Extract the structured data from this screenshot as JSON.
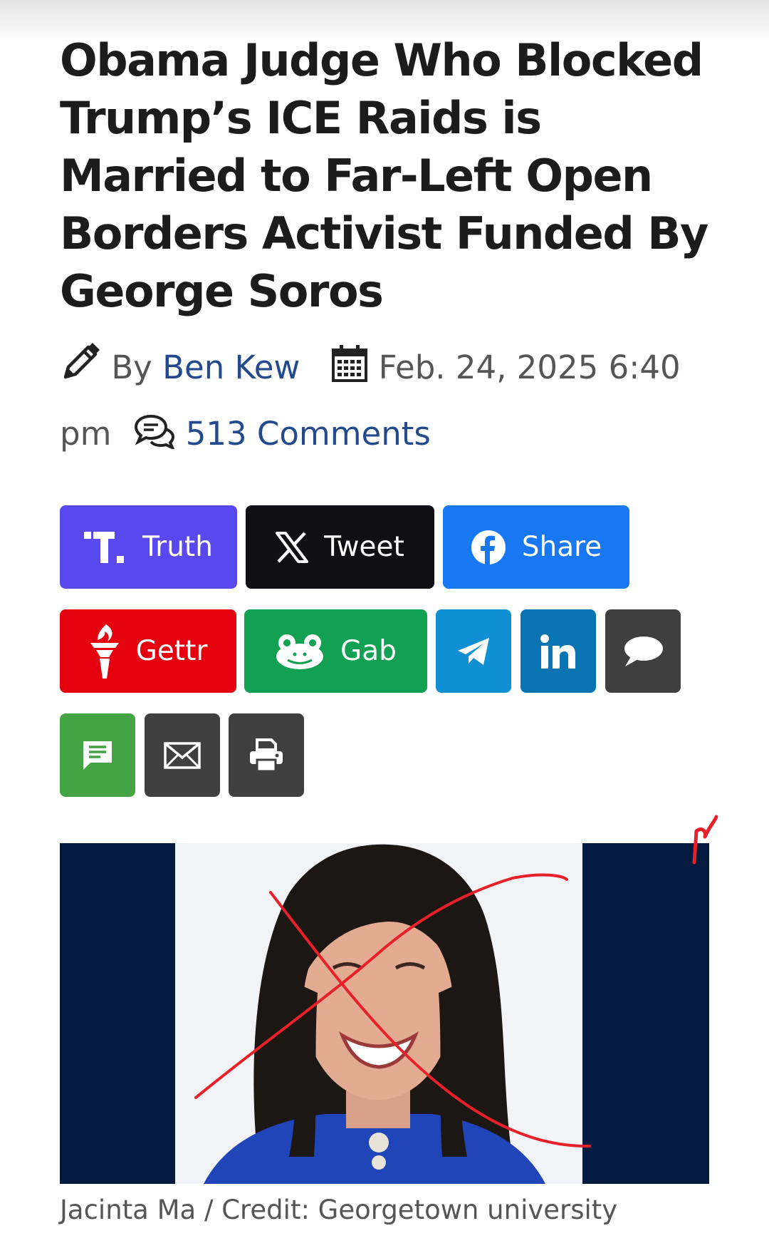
{
  "article": {
    "headline": "Obama Judge Who Blocked Trump’s ICE Raids is Married to Far-Left Open Borders Activist Funded By George Soros",
    "byline_prefix": "By",
    "author": "Ben Kew",
    "date": "Feb. 24, 2025 6:40 pm",
    "comments_label": "513 Comments"
  },
  "share": {
    "truth": "Truth",
    "tweet": "Tweet",
    "facebook": "Share",
    "gettr": "Gettr",
    "gab": "Gab"
  },
  "image": {
    "caption": "Jacinta Ma / Credit: Georgetown university"
  },
  "colors": {
    "truth": "#5948ee",
    "tweet": "#101014",
    "facebook": "#1877f2",
    "gettr": "#e5020e",
    "gab": "#12a152",
    "telegram": "#0f90d2",
    "linkedin": "#0a74b2",
    "dark_gray": "#3f3f3f",
    "sms": "#44a342",
    "link_blue": "#234a8c",
    "scribble_red": "#e8202a"
  },
  "icons": [
    "pencil-icon",
    "calendar-icon",
    "comments-icon",
    "truth-social-icon",
    "x-icon",
    "facebook-icon",
    "gettr-torch-icon",
    "gab-frog-icon",
    "telegram-icon",
    "linkedin-icon",
    "speech-bubble-icon",
    "sms-icon",
    "email-icon",
    "print-icon"
  ]
}
